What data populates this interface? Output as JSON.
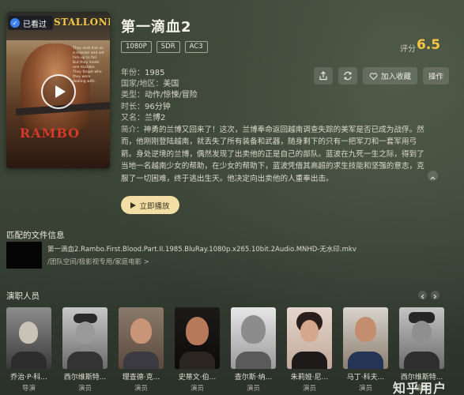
{
  "movie": {
    "title": "第一滴血2",
    "tags": [
      "1080P",
      "SDR",
      "AC3"
    ],
    "rating_label": "评分",
    "rating": "6.5",
    "watched_label": "已看过",
    "meta": [
      {
        "key": "年份：",
        "value": "1985"
      },
      {
        "key": "国家/地区：",
        "value": "美国"
      },
      {
        "key": "类型：",
        "value": "动作/惊悚/冒险"
      },
      {
        "key": "时长：",
        "value": "96分钟"
      },
      {
        "key": "又名：",
        "value": "兰博2"
      }
    ],
    "summary_key": "简介：",
    "summary": "神勇的兰博又回来了！这次，兰博奉命返回越南调查失踪的美军是否已成为战俘。然而，他刚刚登陆越南，就丢失了所有装备和武器，随身剩下的只有一把军刀和一套军用弓箭。身处逆境的兰博，偶然发现了出卖他的正是自己的部队。蓝波在九死一生之际，得到了当地一名越南少女的帮助，在少女的帮助下，蓝波凭借其高超的求生技能和坚强的意志，克服了一切困难，终于逃出生天。他决定向出卖他的人重拳出击。",
    "poster": {
      "title_text": "STALLONE",
      "big_text": "RAMBO",
      "quote": "They sent him on a mission and set him up to fail. But they made one mistake. They forgot who they were dealing with."
    }
  },
  "actions": {
    "share_icon": "share-icon",
    "refresh_icon": "refresh-icon",
    "favorite_label": "加入收藏",
    "operate_label": "操作"
  },
  "play_button_label": "立即播放",
  "files": {
    "title": "匹配的文件信息",
    "name": "第一滴血2.Rambo.First.Blood.Part.II.1985.BluRay.1080p.x265.10bit.2Audio.MNHD-无水印.mkv",
    "path": "/团队空间/极影视专用/家庭电影 >"
  },
  "cast": {
    "title": "演职人员",
    "people": [
      {
        "name": "乔治·P·科...",
        "role": "导演"
      },
      {
        "name": "西尔维斯特...",
        "role": "演员"
      },
      {
        "name": "理查德·克...",
        "role": "演员"
      },
      {
        "name": "史蒂文·伯...",
        "role": "演员"
      },
      {
        "name": "查尔斯·纳...",
        "role": "演员"
      },
      {
        "name": "朱莉娅·尼...",
        "role": "演员"
      },
      {
        "name": "马丁·科夫...",
        "role": "演员"
      },
      {
        "name": "西尔维斯特...",
        "role": "编剧"
      }
    ]
  },
  "watermark": "知乎用户",
  "colors": {
    "rating": "#f6c542",
    "play_button": "#f3dfa6",
    "watched_badge": "#3a82f6"
  }
}
